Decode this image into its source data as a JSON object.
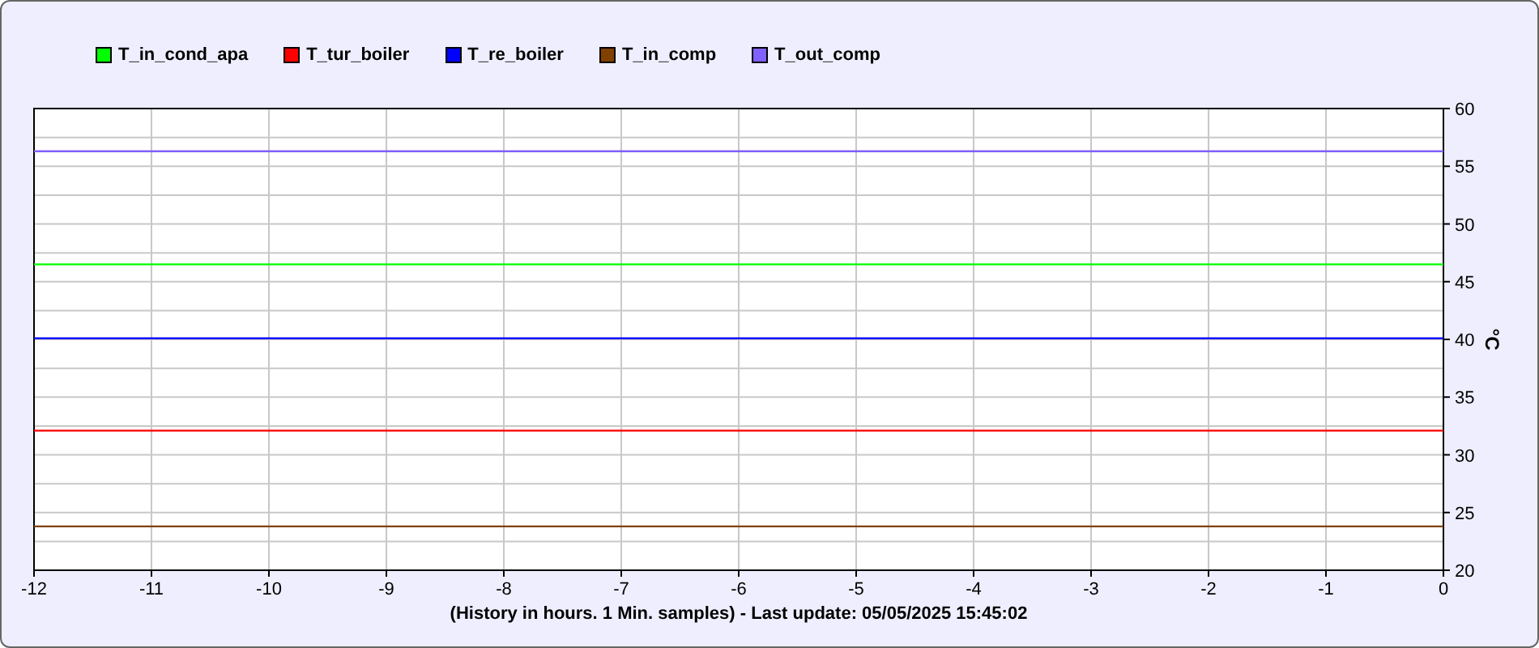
{
  "chart_data": {
    "type": "line",
    "xlabel": "(History in hours. 1 Min. samples) - Last update: 05/05/2025 15:45:02",
    "ylabel": "°C",
    "grid": true,
    "x": [
      -12,
      -11,
      -10,
      -9,
      -8,
      -7,
      -6,
      -5,
      -4,
      -3,
      -2,
      -1,
      0
    ],
    "series": [
      {
        "name": "T_in_cond_apa",
        "color": "#00ff00",
        "values": [
          46.5,
          46.5,
          46.5,
          46.5,
          46.5,
          46.5,
          46.5,
          46.5,
          46.5,
          46.5,
          46.5,
          46.5,
          46.5
        ]
      },
      {
        "name": "T_tur_boiler",
        "color": "#ff0000",
        "values": [
          32.1,
          32.1,
          32.1,
          32.1,
          32.1,
          32.1,
          32.1,
          32.1,
          32.1,
          32.1,
          32.1,
          32.1,
          32.1
        ]
      },
      {
        "name": "T_re_boiler",
        "color": "#0000ff",
        "values": [
          40.1,
          40.1,
          40.1,
          40.1,
          40.1,
          40.1,
          40.1,
          40.1,
          40.1,
          40.1,
          40.1,
          40.1,
          40.1
        ]
      },
      {
        "name": "T_in_comp",
        "color": "#804000",
        "values": [
          23.8,
          23.8,
          23.8,
          23.8,
          23.8,
          23.8,
          23.8,
          23.8,
          23.8,
          23.8,
          23.8,
          23.8,
          23.8
        ]
      },
      {
        "name": "T_out_comp",
        "color": "#8060ff",
        "values": [
          56.3,
          56.3,
          56.3,
          56.3,
          56.3,
          56.3,
          56.3,
          56.3,
          56.3,
          56.3,
          56.3,
          56.3,
          56.3
        ]
      }
    ],
    "ylim": [
      20,
      60
    ],
    "yticks": [
      20,
      25,
      30,
      35,
      40,
      45,
      50,
      55,
      60
    ]
  }
}
